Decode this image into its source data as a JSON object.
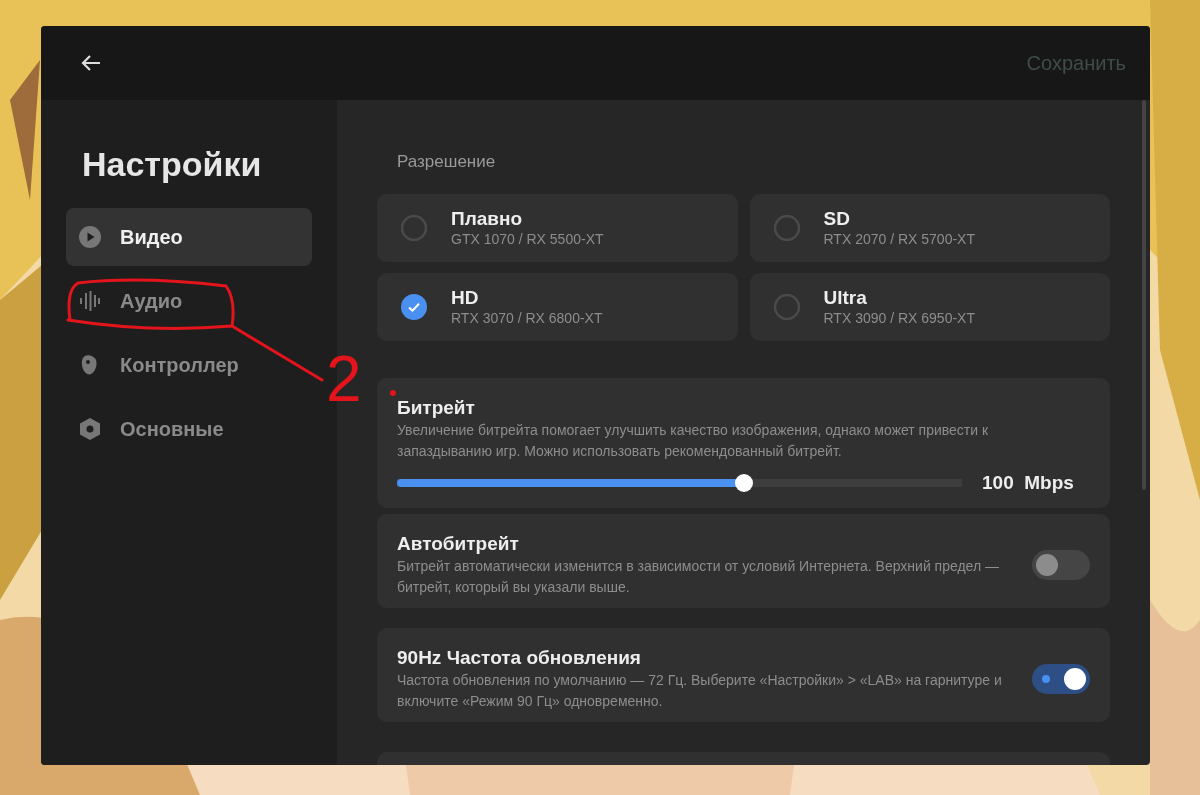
{
  "header": {
    "save": {
      "label": "Сохранить",
      "disabled": true
    }
  },
  "sidebar": {
    "title": "Настройки",
    "items": [
      {
        "label": "Видео",
        "kind": "play",
        "selected": true
      },
      {
        "label": "Аудио",
        "kind": "bars",
        "selected": false
      },
      {
        "label": "Контроллер",
        "kind": "controller",
        "selected": false
      },
      {
        "label": "Основные",
        "kind": "hex",
        "selected": false
      }
    ]
  },
  "resolution": {
    "title": "Разрешение",
    "options": [
      {
        "label": "Плавно",
        "hint": "GTX 1070 / RX 5500-XT",
        "selected": false
      },
      {
        "label": "SD",
        "hint": "RTX 2070 / RX 5700-XT",
        "selected": false
      },
      {
        "label": "HD",
        "hint": "RTX 3070 / RX 6800-XT",
        "selected": true
      },
      {
        "label": "Ultra",
        "hint": "RTX 3090 / RX 6950-XT",
        "selected": false
      }
    ]
  },
  "settings": [
    {
      "kind": "slider",
      "title": "Битрейт",
      "description": "Увеличение битрейта помогает улучшить качество изображения, однако может привести к запаздыванию игр. Можно использовать рекомендованный битрейт.",
      "level": 0.614,
      "reading": "100  Mbps"
    },
    {
      "kind": "toggle",
      "title": "Автобитрейт",
      "description": "Битрейт автоматически изменится в зависимости от условий Интернета. Верхний предел — битрейт, который вы указали выше.",
      "on": false
    },
    {
      "kind": "toggle",
      "title": "90Hz Частота обновления",
      "description": "Частота обновления по умолчанию — 72 Гц. Выберите «Настройки» > «LAB» на гарнитуре и включите «Режим 90 Гц» одновременно.",
      "on": true
    }
  ],
  "annotation": {
    "label": "2",
    "color": "#e3141b"
  }
}
